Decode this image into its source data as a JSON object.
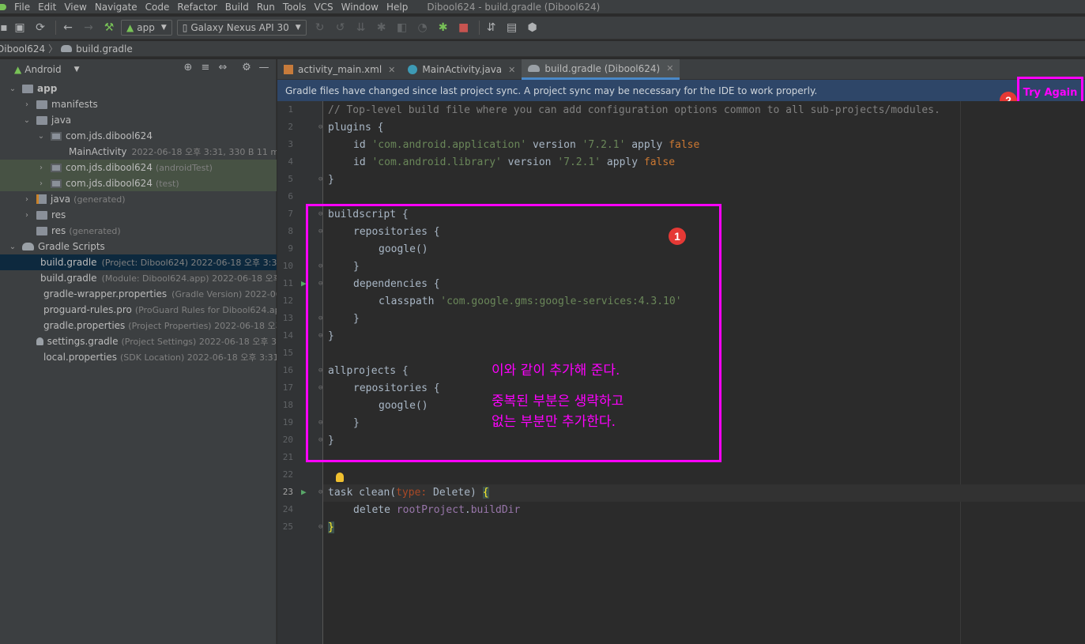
{
  "window": {
    "title": "Dibool624 - build.gradle (Dibool624)"
  },
  "menu": [
    "File",
    "Edit",
    "View",
    "Navigate",
    "Code",
    "Refactor",
    "Build",
    "Run",
    "Tools",
    "VCS",
    "Window",
    "Help"
  ],
  "toolbar": {
    "module": "app",
    "device": "Galaxy Nexus API 30"
  },
  "breadcrumb": {
    "project": "Dibool624",
    "file": "build.gradle"
  },
  "project_panel": {
    "view": "Android",
    "items": [
      {
        "label": "app",
        "meta": ""
      },
      {
        "label": "manifests",
        "meta": ""
      },
      {
        "label": "java",
        "meta": ""
      },
      {
        "label": "com.jds.dibool624",
        "meta": ""
      },
      {
        "label": "MainActivity",
        "meta": "2022-06-18 오후 3:31, 330 B 11 m"
      },
      {
        "label": "com.jds.dibool624",
        "meta": "(androidTest)"
      },
      {
        "label": "com.jds.dibool624",
        "meta": "(test)"
      },
      {
        "label": "java",
        "meta": "(generated)"
      },
      {
        "label": "res",
        "meta": ""
      },
      {
        "label": "res",
        "meta": "(generated)"
      },
      {
        "label": "Gradle Scripts",
        "meta": ""
      },
      {
        "label": "build.gradle",
        "meta": "(Project: Dibool624)  2022-06-18 오후 3:3"
      },
      {
        "label": "build.gradle",
        "meta": "(Module: Dibool624.app)  2022-06-18 오후 3"
      },
      {
        "label": "gradle-wrapper.properties",
        "meta": "(Gradle Version)  2022-06-1"
      },
      {
        "label": "proguard-rules.pro",
        "meta": "(ProGuard Rules for Dibool624.ap"
      },
      {
        "label": "gradle.properties",
        "meta": "(Project Properties)  2022-06-18 오후"
      },
      {
        "label": "settings.gradle",
        "meta": "(Project Settings)  2022-06-18 오후 3"
      },
      {
        "label": "local.properties",
        "meta": "(SDK Location)  2022-06-18 오후 3:31"
      }
    ]
  },
  "tabs": [
    {
      "label": "activity_main.xml"
    },
    {
      "label": "MainActivity.java"
    },
    {
      "label": "build.gradle (Dibool624)"
    }
  ],
  "notification": {
    "message": "Gradle files have changed since last project sync. A project sync may be necessary for the IDE to work properly.",
    "action": "Try Again"
  },
  "code": {
    "line_numbers": [
      "1",
      "2",
      "3",
      "4",
      "5",
      "6",
      "7",
      "8",
      "9",
      "10",
      "11",
      "12",
      "13",
      "14",
      "15",
      "16",
      "17",
      "18",
      "19",
      "20",
      "21",
      "22",
      "23",
      "24",
      "25"
    ],
    "l1": "// Top-level build file where you can add configuration options common to all sub-projects/modules.",
    "l2_kw": "plugins",
    "l3_a": "id ",
    "l3_s": "'com.android.application'",
    "l3_b": " version ",
    "l3_v": "'7.2.1'",
    "l3_c": " apply ",
    "l3_f": "false",
    "l4_a": "id ",
    "l4_s": "'com.android.library'",
    "l4_b": " version ",
    "l4_v": "'7.2.1'",
    "l4_c": " apply ",
    "l4_f": "false",
    "l7": "buildscript {",
    "l8": "repositories {",
    "l9": "google()",
    "l11": "dependencies {",
    "l12_a": "classpath ",
    "l12_s": "'com.google.gms:google-services:4.3.10'",
    "l16": "allprojects {",
    "l17": "repositories {",
    "l18": "google()",
    "l23_a": "task clean(",
    "l23_p": "type:",
    "l23_b": " Delete) ",
    "l23_brace": "{",
    "l24_a": "delete ",
    "l24_p": "rootProject",
    "l24_b": ".",
    "l24_q": "buildDir",
    "close": "}",
    "open": " {"
  },
  "annotations": {
    "badge1": "1",
    "badge2": "2",
    "note1": "이와 같이 추가해 준다.",
    "note2": "중복된 부분은 생략하고",
    "note3": "없는 부분만 추가한다."
  }
}
